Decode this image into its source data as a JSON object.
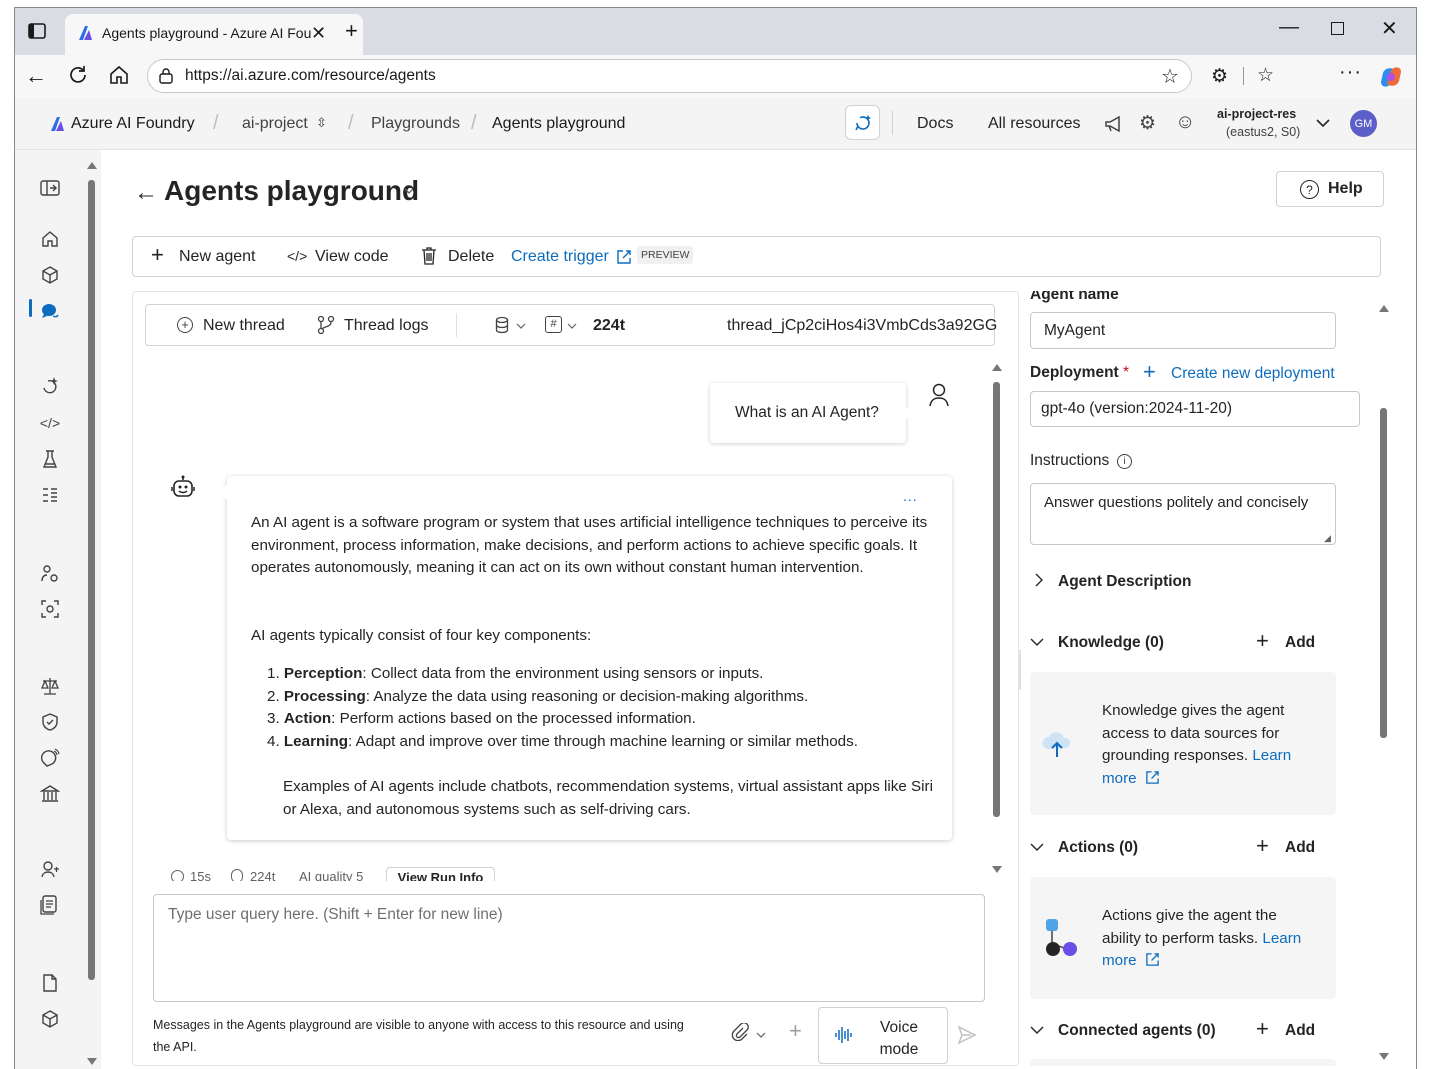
{
  "browser": {
    "tab_title": "Agents playground - Azure AI Fou",
    "url": "https://ai.azure.com/resource/agents"
  },
  "header": {
    "brand": "Azure AI Foundry",
    "project": "ai-project",
    "crumb_playgrounds": "Playgrounds",
    "crumb_current": "Agents playground",
    "docs": "Docs",
    "all_resources": "All resources",
    "resource_name": "ai-project-res",
    "resource_region": "(eastus2, S0)",
    "avatar_initials": "GM"
  },
  "page": {
    "title": "Agents playground",
    "help": "Help"
  },
  "toolbar": {
    "new_agent": "New agent",
    "view_code": "View code",
    "delete": "Delete",
    "create_trigger": "Create trigger",
    "preview_badge": "PREVIEW"
  },
  "thread_bar": {
    "new_thread": "New thread",
    "thread_logs": "Thread logs",
    "tokens": "224t",
    "thread_id": "thread_jCp2ciHos4i3VmbCds3a92GG"
  },
  "chat": {
    "user_message": "What is an AI Agent?",
    "more": "...",
    "p1": "An AI agent is a software program or system that uses artificial intelligence techniques to perceive its environment, process information, make decisions, and perform actions to achieve specific goals. It operates autonomously, meaning it can act on its own without constant human intervention.",
    "p2": "AI agents typically consist of four key components:",
    "items": [
      {
        "num": "1.",
        "term": "Perception",
        "text": ": Collect data from the environment using sensors or inputs."
      },
      {
        "num": "2.",
        "term": "Processing",
        "text": ": Analyze the data using reasoning or decision-making algorithms."
      },
      {
        "num": "3.",
        "term": "Action",
        "text": ": Perform actions based on the processed information."
      },
      {
        "num": "4.",
        "term": "Learning",
        "text": ": Adapt and improve over time through machine learning or similar methods."
      }
    ],
    "p3": "Examples of AI agents include chatbots, recommendation systems, virtual assistant apps like Siri or Alexa, and autonomous systems such as self-driving cars.",
    "meta_time": "15s",
    "meta_tokens": "224t",
    "meta_quality": "AI quality 5",
    "view_run_info": "View Run Info",
    "input_placeholder": "Type user query here. (Shift + Enter for new line)",
    "disclaimer": "Messages in the Agents playground are visible to anyone with access to this resource and using the API.",
    "voice_mode_line1": "Voice",
    "voice_mode_line2": "mode"
  },
  "setup": {
    "agent_name_label": "Agent name",
    "agent_name_value": "MyAgent",
    "deployment_label": "Deployment",
    "required_mark": "*",
    "create_deployment": "Create new deployment",
    "deployment_value": "gpt-4o (version:2024-11-20)",
    "instructions_label": "Instructions",
    "instructions_value": "Answer questions politely and concisely",
    "agent_description": "Agent Description",
    "knowledge_label": "Knowledge (0)",
    "add": "Add",
    "knowledge_text": "Knowledge gives the agent access to data sources for grounding responses.",
    "learn": "Learn",
    "more": "more",
    "actions_label": "Actions (0)",
    "actions_text": "Actions give the agent the ability to perform tasks.",
    "connected_label": "Connected agents (0)"
  },
  "colors": {
    "accent": "#0f6cbd",
    "avatar_bg": "#5b5fc7",
    "brand_blue": "#1f6fd6"
  }
}
